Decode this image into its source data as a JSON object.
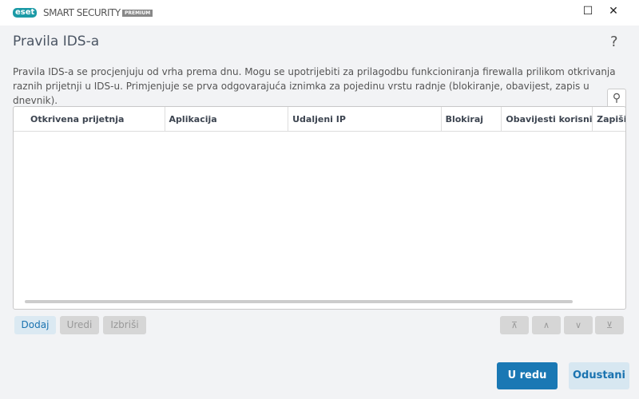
{
  "app": {
    "logo": "eset",
    "product": "SMART SECURITY",
    "edition": "PREMIUM"
  },
  "window": {
    "minimize": "—",
    "maximize": "☐",
    "close": "✕"
  },
  "page": {
    "title": "Pravila IDS-a",
    "help": "?",
    "description": "Pravila IDS-a se procjenjuju od vrha prema dnu. Mogu se upotrijebiti za prilagodbu funkcioniranja firewalla prilikom otkrivanja raznih prijetnji u IDS-u. Primjenjuje se prva odgovarajuća iznimka za pojedinu vrstu radnje (blokiranje, obavijest, zapis u dnevnik)."
  },
  "table": {
    "columns": [
      "Otkrivena prijetnja",
      "Aplikacija",
      "Udaljeni IP",
      "Blokiraj",
      "Obavijesti korisnika",
      "Zapiši u"
    ]
  },
  "actions": {
    "add": "Dodaj",
    "edit": "Uredi",
    "delete": "Izbriši"
  },
  "move": {
    "top": "⊼",
    "up": "∧",
    "down": "∨",
    "bottom": "⊻"
  },
  "footer": {
    "ok": "U redu",
    "cancel": "Odustani"
  }
}
